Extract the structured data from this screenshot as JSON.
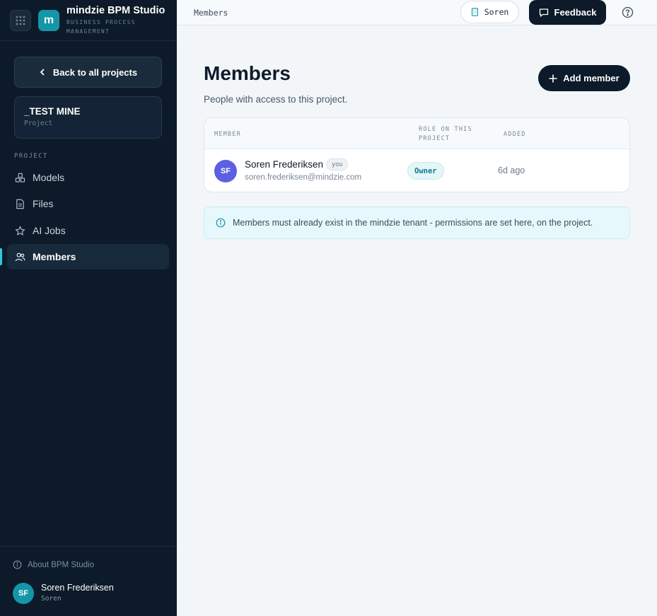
{
  "brand": {
    "title": "mindzie BPM Studio",
    "subtitle": "BUSINESS PROCESS MANAGEMENT",
    "logo_letter": "m"
  },
  "sidebar": {
    "back_label": "Back to all projects",
    "project": {
      "name": "_TEST MINE",
      "type": "Project"
    },
    "section_label": "PROJECT",
    "items": [
      {
        "label": "Models",
        "icon": "models-icon",
        "active": false
      },
      {
        "label": "Files",
        "icon": "file-icon",
        "active": false
      },
      {
        "label": "AI Jobs",
        "icon": "star-icon",
        "active": false
      },
      {
        "label": "Members",
        "icon": "users-icon",
        "active": true
      }
    ],
    "about_label": "About BPM Studio",
    "user": {
      "initials": "SF",
      "name": "Soren Frederiksen",
      "tenant": "Soren"
    }
  },
  "topbar": {
    "breadcrumb": "Members",
    "tenant_label": "Soren",
    "feedback_label": "Feedback"
  },
  "main": {
    "title": "Members",
    "subtitle": "People with access to this project.",
    "add_label": "Add member",
    "table": {
      "headers": {
        "member": "MEMBER",
        "role": "ROLE ON THIS PROJECT",
        "added": "ADDED"
      },
      "rows": [
        {
          "initials": "SF",
          "name": "Soren Frederiksen",
          "you_badge": "you",
          "email": "soren.frederiksen@mindzie.com",
          "role": "Owner",
          "added": "6d ago"
        }
      ]
    },
    "note": "Members must already exist in the mindzie tenant - permissions are set here, on the project."
  },
  "colors": {
    "sidebar_bg": "#0c1a29",
    "accent": "#1596a8",
    "member_avatar": "#5b5fe0",
    "active_indicator": "#33c7dc"
  }
}
